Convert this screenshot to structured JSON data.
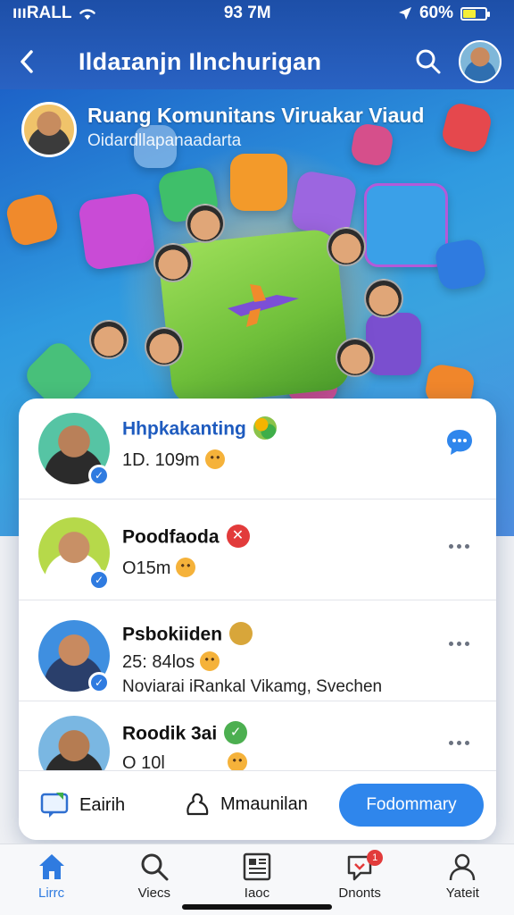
{
  "status_bar": {
    "carrier": "ıııRALL",
    "time": "93 7M",
    "battery": "60%",
    "battery_level": 0.6
  },
  "header": {
    "title": "Ildaɪanjn Ilnchurigan"
  },
  "hero": {
    "title": "Ruang Komunitans Viruakar Viaud",
    "subtitle": "Oidardllapanaadarta"
  },
  "members": [
    {
      "name": "Hhpkakanting",
      "meta": "1D. 109m",
      "action": "chat"
    },
    {
      "name": "Poodfaoda",
      "meta": "O15m",
      "action": "more"
    },
    {
      "name": "Psbokiiden",
      "meta": "25: 84los",
      "description": "Noviarai iRankal Vikamg, Svechen",
      "action": "more"
    },
    {
      "name": "Roodik 3ai",
      "meta": "O 10l",
      "action": "more"
    }
  ],
  "actions": {
    "edit_label": "Eairih",
    "community_label": "Mmaunilan",
    "primary_label": "Fodommary"
  },
  "bottom_nav": [
    {
      "label": "Lirrc",
      "icon": "home-icon",
      "active": true
    },
    {
      "label": "Viecs",
      "icon": "search-icon",
      "active": false
    },
    {
      "label": "Iaoc",
      "icon": "news-icon",
      "active": false
    },
    {
      "label": "Dnonts",
      "icon": "notifications-icon",
      "active": false,
      "badge": "1"
    },
    {
      "label": "Yateit",
      "icon": "profile-icon",
      "active": false
    }
  ],
  "colors": {
    "header_bg": "#1d4fa8",
    "accent": "#2f86ec",
    "verified": "#2f7be0",
    "notification": "#e23b3b"
  }
}
